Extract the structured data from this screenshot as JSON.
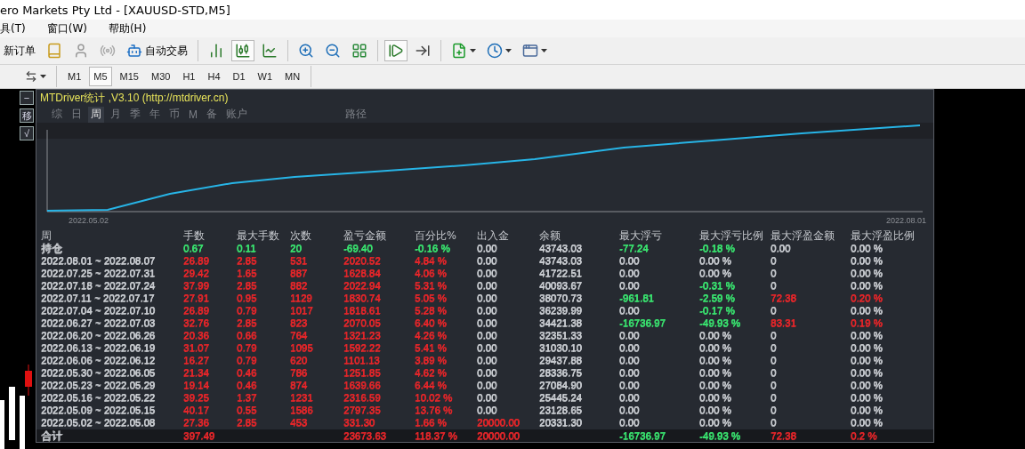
{
  "window": {
    "title": "ero Markets Pty Ltd - [XAUUSD-STD,M5]"
  },
  "menu": [
    "具(T)",
    "窗口(W)",
    "帮助(H)"
  ],
  "toolbar": [
    {
      "kind": "text",
      "label": "新订单"
    },
    {
      "kind": "book"
    },
    {
      "kind": "person"
    },
    {
      "kind": "signal"
    },
    {
      "kind": "robot",
      "label": "自动交易"
    },
    {
      "kind": "sep"
    },
    {
      "kind": "bars",
      "selected": false
    },
    {
      "kind": "candles",
      "selected": true
    },
    {
      "kind": "line",
      "selected": false
    },
    {
      "kind": "sep"
    },
    {
      "kind": "zoomin"
    },
    {
      "kind": "zoomout"
    },
    {
      "kind": "tile"
    },
    {
      "kind": "sep"
    },
    {
      "kind": "autoscroll",
      "selected": true
    },
    {
      "kind": "shift",
      "selected": false
    },
    {
      "kind": "sep"
    },
    {
      "kind": "indicator"
    },
    {
      "kind": "clock"
    },
    {
      "kind": "template"
    }
  ],
  "timeframes": [
    {
      "label": "M1",
      "selected": false
    },
    {
      "label": "M5",
      "selected": true
    },
    {
      "label": "M15",
      "selected": false
    },
    {
      "label": "M30",
      "selected": false
    },
    {
      "label": "H1",
      "selected": false
    },
    {
      "label": "H4",
      "selected": false
    },
    {
      "label": "D1",
      "selected": false
    },
    {
      "label": "W1",
      "selected": false
    },
    {
      "label": "MN",
      "selected": false
    }
  ],
  "side_buttons": [
    "−",
    "移",
    "√"
  ],
  "panel": {
    "title": "MTDriver统计 ,V3.10 (http://mtdriver.cn)",
    "tabs": [
      {
        "label": "综",
        "selected": false
      },
      {
        "label": "日",
        "selected": false
      },
      {
        "label": "周",
        "selected": true
      },
      {
        "label": "月",
        "selected": false
      },
      {
        "label": "季",
        "selected": false
      },
      {
        "label": "年",
        "selected": false
      },
      {
        "label": "币",
        "selected": false
      },
      {
        "label": "M",
        "selected": false
      },
      {
        "label": "备",
        "selected": false
      },
      {
        "label": "账户",
        "selected": false
      },
      {
        "label": "路径",
        "selected": false
      }
    ],
    "chart": {
      "start_label": "2022.05.02",
      "end_label": "2022.08.01"
    },
    "table": {
      "columns": [
        "周",
        "手数",
        "最大手数",
        "次数",
        "盈亏金额",
        "百分比%",
        "出入金",
        "余额",
        "最大浮亏",
        "最大浮亏比例",
        "最大浮盈金额",
        "最大浮盈比例"
      ],
      "rows": [
        {
          "cells": [
            {
              "text": "持仓"
            },
            {
              "text": "0.67",
              "color": "#39e06e"
            },
            {
              "text": "0.11",
              "color": "#39e06e"
            },
            {
              "text": "20",
              "color": "#39e06e"
            },
            {
              "text": "-69.40",
              "color": "#39e06e"
            },
            {
              "text": "-0.16 %",
              "color": "#39e06e"
            },
            {
              "text": "0.00"
            },
            {
              "text": "43743.03"
            },
            {
              "text": "-77.24",
              "color": "#39e06e"
            },
            {
              "text": "-0.18 %",
              "color": "#39e06e"
            },
            {
              "text": "0.00"
            },
            {
              "text": "0.00 %"
            }
          ]
        },
        {
          "cells": [
            {
              "text": "2022.08.01 ~ 2022.08.07"
            },
            {
              "text": "26.89",
              "color": "#e3262a"
            },
            {
              "text": "2.85",
              "color": "#e3262a"
            },
            {
              "text": "531",
              "color": "#e3262a"
            },
            {
              "text": "2020.52",
              "color": "#e3262a"
            },
            {
              "text": "4.84 %",
              "color": "#e3262a"
            },
            {
              "text": "0.00"
            },
            {
              "text": "43743.03"
            },
            {
              "text": "0.00"
            },
            {
              "text": "0.00 %"
            },
            {
              "text": "0"
            },
            {
              "text": "0.00 %"
            }
          ]
        },
        {
          "cells": [
            {
              "text": "2022.07.25 ~ 2022.07.31"
            },
            {
              "text": "29.42",
              "color": "#e3262a"
            },
            {
              "text": "1.65",
              "color": "#e3262a"
            },
            {
              "text": "887",
              "color": "#e3262a"
            },
            {
              "text": "1628.84",
              "color": "#e3262a"
            },
            {
              "text": "4.06 %",
              "color": "#e3262a"
            },
            {
              "text": "0.00"
            },
            {
              "text": "41722.51"
            },
            {
              "text": "0.00"
            },
            {
              "text": "0.00 %"
            },
            {
              "text": "0"
            },
            {
              "text": "0.00 %"
            }
          ]
        },
        {
          "cells": [
            {
              "text": "2022.07.18 ~ 2022.07.24"
            },
            {
              "text": "37.99",
              "color": "#e3262a"
            },
            {
              "text": "2.85",
              "color": "#e3262a"
            },
            {
              "text": "882",
              "color": "#e3262a"
            },
            {
              "text": "2022.94",
              "color": "#e3262a"
            },
            {
              "text": "5.31 %",
              "color": "#e3262a"
            },
            {
              "text": "0.00"
            },
            {
              "text": "40093.67"
            },
            {
              "text": "0.00"
            },
            {
              "text": "-0.31 %",
              "color": "#39e06e"
            },
            {
              "text": "0"
            },
            {
              "text": "0.00 %"
            }
          ]
        },
        {
          "cells": [
            {
              "text": "2022.07.11 ~ 2022.07.17"
            },
            {
              "text": "27.91",
              "color": "#e3262a"
            },
            {
              "text": "0.95",
              "color": "#e3262a"
            },
            {
              "text": "1129",
              "color": "#e3262a"
            },
            {
              "text": "1830.74",
              "color": "#e3262a"
            },
            {
              "text": "5.05 %",
              "color": "#e3262a"
            },
            {
              "text": "0.00"
            },
            {
              "text": "38070.73"
            },
            {
              "text": "-961.81",
              "color": "#39e06e"
            },
            {
              "text": "-2.59 %",
              "color": "#39e06e"
            },
            {
              "text": "72.38",
              "color": "#e3262a"
            },
            {
              "text": "0.20 %",
              "color": "#e3262a"
            }
          ]
        },
        {
          "cells": [
            {
              "text": "2022.07.04 ~ 2022.07.10"
            },
            {
              "text": "26.89",
              "color": "#e3262a"
            },
            {
              "text": "0.79",
              "color": "#e3262a"
            },
            {
              "text": "1017",
              "color": "#e3262a"
            },
            {
              "text": "1818.61",
              "color": "#e3262a"
            },
            {
              "text": "5.28 %",
              "color": "#e3262a"
            },
            {
              "text": "0.00"
            },
            {
              "text": "36239.99"
            },
            {
              "text": "0.00"
            },
            {
              "text": "-0.17 %",
              "color": "#39e06e"
            },
            {
              "text": "0"
            },
            {
              "text": "0.00 %"
            }
          ]
        },
        {
          "cells": [
            {
              "text": "2022.06.27 ~ 2022.07.03"
            },
            {
              "text": "32.76",
              "color": "#e3262a"
            },
            {
              "text": "2.85",
              "color": "#e3262a"
            },
            {
              "text": "823",
              "color": "#e3262a"
            },
            {
              "text": "2070.05",
              "color": "#e3262a"
            },
            {
              "text": "6.40 %",
              "color": "#e3262a"
            },
            {
              "text": "0.00"
            },
            {
              "text": "34421.38"
            },
            {
              "text": "-16736.97",
              "color": "#39e06e"
            },
            {
              "text": "-49.93 %",
              "color": "#39e06e"
            },
            {
              "text": "83.31",
              "color": "#e3262a"
            },
            {
              "text": "0.19 %",
              "color": "#e3262a"
            }
          ]
        },
        {
          "cells": [
            {
              "text": "2022.06.20 ~ 2022.06.26"
            },
            {
              "text": "20.36",
              "color": "#e3262a"
            },
            {
              "text": "0.66",
              "color": "#e3262a"
            },
            {
              "text": "764",
              "color": "#e3262a"
            },
            {
              "text": "1321.23",
              "color": "#e3262a"
            },
            {
              "text": "4.26 %",
              "color": "#e3262a"
            },
            {
              "text": "0.00"
            },
            {
              "text": "32351.33"
            },
            {
              "text": "0.00"
            },
            {
              "text": "0.00 %"
            },
            {
              "text": "0"
            },
            {
              "text": "0.00 %"
            }
          ]
        },
        {
          "cells": [
            {
              "text": "2022.06.13 ~ 2022.06.19"
            },
            {
              "text": "31.07",
              "color": "#e3262a"
            },
            {
              "text": "0.79",
              "color": "#e3262a"
            },
            {
              "text": "1095",
              "color": "#e3262a"
            },
            {
              "text": "1592.22",
              "color": "#e3262a"
            },
            {
              "text": "5.41 %",
              "color": "#e3262a"
            },
            {
              "text": "0.00"
            },
            {
              "text": "31030.10"
            },
            {
              "text": "0.00"
            },
            {
              "text": "0.00 %"
            },
            {
              "text": "0"
            },
            {
              "text": "0.00 %"
            }
          ]
        },
        {
          "cells": [
            {
              "text": "2022.06.06 ~ 2022.06.12"
            },
            {
              "text": "16.27",
              "color": "#e3262a"
            },
            {
              "text": "0.79",
              "color": "#e3262a"
            },
            {
              "text": "620",
              "color": "#e3262a"
            },
            {
              "text": "1101.13",
              "color": "#e3262a"
            },
            {
              "text": "3.89 %",
              "color": "#e3262a"
            },
            {
              "text": "0.00"
            },
            {
              "text": "29437.88"
            },
            {
              "text": "0.00"
            },
            {
              "text": "0.00 %"
            },
            {
              "text": "0"
            },
            {
              "text": "0.00 %"
            }
          ]
        },
        {
          "cells": [
            {
              "text": "2022.05.30 ~ 2022.06.05"
            },
            {
              "text": "21.34",
              "color": "#e3262a"
            },
            {
              "text": "0.46",
              "color": "#e3262a"
            },
            {
              "text": "786",
              "color": "#e3262a"
            },
            {
              "text": "1251.85",
              "color": "#e3262a"
            },
            {
              "text": "4.62 %",
              "color": "#e3262a"
            },
            {
              "text": "0.00"
            },
            {
              "text": "28336.75"
            },
            {
              "text": "0.00"
            },
            {
              "text": "0.00 %"
            },
            {
              "text": "0"
            },
            {
              "text": "0.00 %"
            }
          ]
        },
        {
          "cells": [
            {
              "text": "2022.05.23 ~ 2022.05.29"
            },
            {
              "text": "19.14",
              "color": "#e3262a"
            },
            {
              "text": "0.46",
              "color": "#e3262a"
            },
            {
              "text": "874",
              "color": "#e3262a"
            },
            {
              "text": "1639.66",
              "color": "#e3262a"
            },
            {
              "text": "6.44 %",
              "color": "#e3262a"
            },
            {
              "text": "0.00"
            },
            {
              "text": "27084.90"
            },
            {
              "text": "0.00"
            },
            {
              "text": "0.00 %"
            },
            {
              "text": "0"
            },
            {
              "text": "0.00 %"
            }
          ]
        },
        {
          "cells": [
            {
              "text": "2022.05.16 ~ 2022.05.22"
            },
            {
              "text": "39.25",
              "color": "#e3262a"
            },
            {
              "text": "1.37",
              "color": "#e3262a"
            },
            {
              "text": "1231",
              "color": "#e3262a"
            },
            {
              "text": "2316.59",
              "color": "#e3262a"
            },
            {
              "text": "10.02 %",
              "color": "#e3262a"
            },
            {
              "text": "0.00"
            },
            {
              "text": "25445.24"
            },
            {
              "text": "0.00"
            },
            {
              "text": "0.00 %"
            },
            {
              "text": "0"
            },
            {
              "text": "0.00 %"
            }
          ]
        },
        {
          "cells": [
            {
              "text": "2022.05.09 ~ 2022.05.15"
            },
            {
              "text": "40.17",
              "color": "#e3262a"
            },
            {
              "text": "0.55",
              "color": "#e3262a"
            },
            {
              "text": "1586",
              "color": "#e3262a"
            },
            {
              "text": "2797.35",
              "color": "#e3262a"
            },
            {
              "text": "13.76 %",
              "color": "#e3262a"
            },
            {
              "text": "0.00"
            },
            {
              "text": "23128.65"
            },
            {
              "text": "0.00"
            },
            {
              "text": "0.00 %"
            },
            {
              "text": "0"
            },
            {
              "text": "0.00 %"
            }
          ]
        },
        {
          "cells": [
            {
              "text": "2022.05.02 ~ 2022.05.08"
            },
            {
              "text": "27.36",
              "color": "#e3262a"
            },
            {
              "text": "2.85",
              "color": "#e3262a"
            },
            {
              "text": "453",
              "color": "#e3262a"
            },
            {
              "text": "331.30",
              "color": "#e3262a"
            },
            {
              "text": "1.66 %",
              "color": "#e3262a"
            },
            {
              "text": "20000.00",
              "color": "#e3262a"
            },
            {
              "text": "20331.30"
            },
            {
              "text": "0.00"
            },
            {
              "text": "0.00 %"
            },
            {
              "text": "0"
            },
            {
              "text": "0.00 %"
            }
          ]
        }
      ],
      "total": {
        "cells": [
          {
            "text": "合计"
          },
          {
            "text": "397.49",
            "color": "#e3262a"
          },
          {
            "text": ""
          },
          {
            "text": ""
          },
          {
            "text": "23673.63",
            "color": "#e3262a"
          },
          {
            "text": "118.37 %",
            "color": "#e3262a"
          },
          {
            "text": "20000.00",
            "color": "#e3262a"
          },
          {
            "text": ""
          },
          {
            "text": "-16736.97",
            "color": "#39e06e"
          },
          {
            "text": "-49.93 %",
            "color": "#39e06e"
          },
          {
            "text": "72.38",
            "color": "#e3262a"
          },
          {
            "text": "0.2 %",
            "color": "#e3262a"
          }
        ]
      }
    }
  }
}
